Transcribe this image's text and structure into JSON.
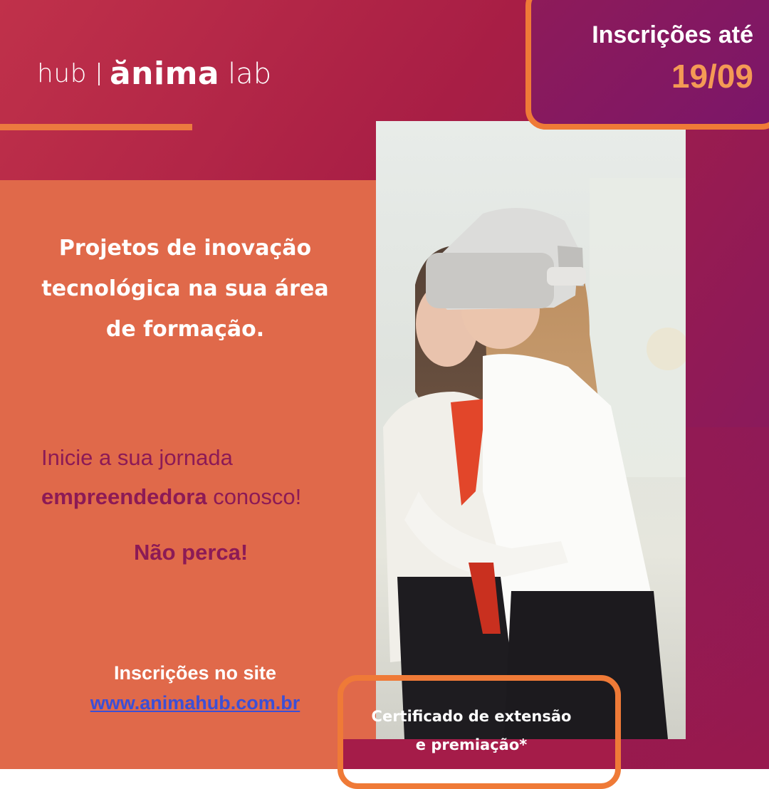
{
  "brand": {
    "hub": "hub",
    "anima": "ănima",
    "lab": "lab"
  },
  "deadline": {
    "label": "Inscrições até",
    "date": "19/09"
  },
  "headline": {
    "line1": "Projetos de inovação",
    "line2": "tecnológica na sua área",
    "line3": "de formação."
  },
  "journey": {
    "line1": "Inicie a sua jornada",
    "bold": "empreendedora",
    "rest": " conosco!"
  },
  "cta": "Não perca!",
  "signup": {
    "label": "Inscrições no site",
    "url": "www.animahub.com.br"
  },
  "certificate": {
    "line1": "Certificado de extensão",
    "line2": "e premiação*"
  },
  "photo": {
    "icon": "vr-headset-photo"
  },
  "colors": {
    "orange": "#e0694a",
    "accent_orange": "#ef7a37",
    "magenta": "#8c1a56",
    "link_blue": "#3c4fd6"
  }
}
